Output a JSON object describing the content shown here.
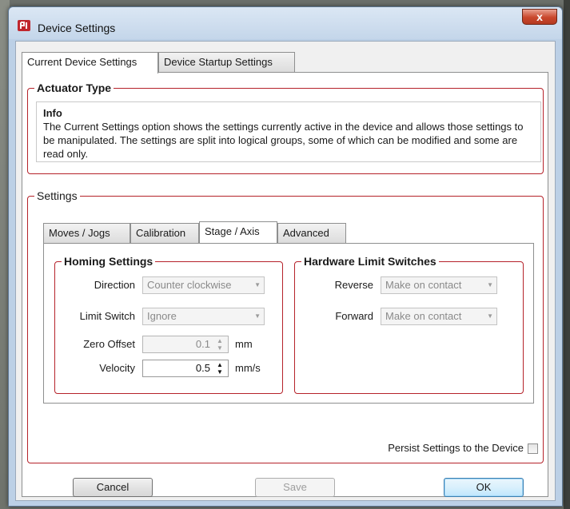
{
  "window": {
    "title": "Device Settings",
    "close_label": "x"
  },
  "outer_tabs": [
    {
      "label": "Current Device Settings",
      "active": true
    },
    {
      "label": "Device Startup Settings",
      "active": false
    }
  ],
  "actuator_group": {
    "title": "Actuator Type",
    "info_title": "Info",
    "info_body": "The Current Settings option shows the settings currently active in the device and allows those settings to be manipulated. The settings are split into logical groups, some of which can be modified and some are read only."
  },
  "settings_group": {
    "title": "Settings",
    "inner_tabs": [
      {
        "label": "Moves / Jogs",
        "active": false
      },
      {
        "label": "Calibration",
        "active": false
      },
      {
        "label": "Stage / Axis",
        "active": true
      },
      {
        "label": "Advanced",
        "active": false
      }
    ],
    "homing": {
      "title": "Homing Settings",
      "direction_label": "Direction",
      "direction_value": "Counter clockwise",
      "limit_switch_label": "Limit Switch",
      "limit_switch_value": "Ignore",
      "zero_offset_label": "Zero Offset",
      "zero_offset_value": "0.1",
      "zero_offset_unit": "mm",
      "velocity_label": "Velocity",
      "velocity_value": "0.5",
      "velocity_unit": "mm/s"
    },
    "limits": {
      "title": "Hardware Limit Switches",
      "reverse_label": "Reverse",
      "reverse_value": "Make on contact",
      "forward_label": "Forward",
      "forward_value": "Make on contact"
    },
    "persist_label": "Persist Settings to the Device",
    "persist_checked": false
  },
  "buttons": {
    "cancel": "Cancel",
    "save": "Save",
    "ok": "OK"
  },
  "colors": {
    "group_border": "#b5222a",
    "default_button_border": "#3c7fb1"
  },
  "icons": {
    "app": "device-app-icon",
    "dropdown": "chevron-down-icon",
    "spinner": "spin-updown-icon"
  }
}
